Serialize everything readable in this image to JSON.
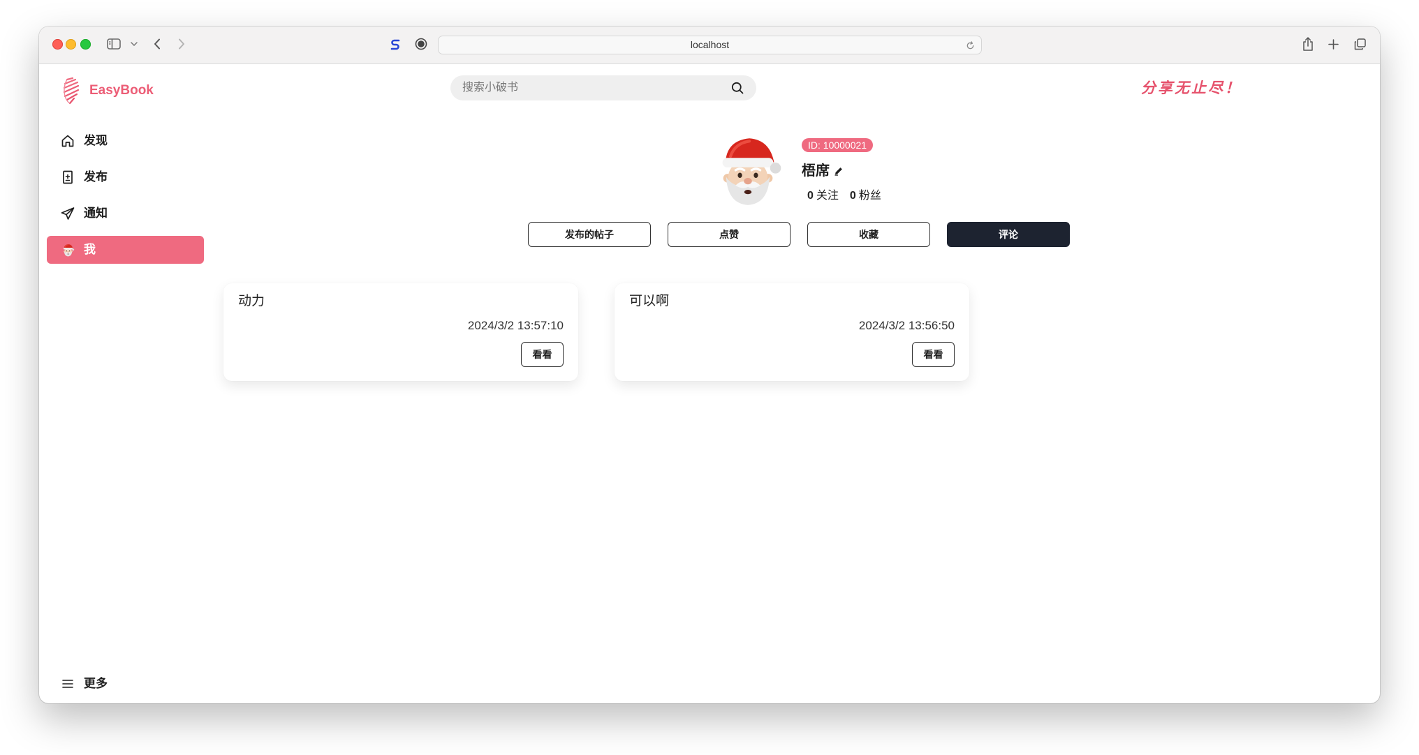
{
  "browser": {
    "url": "localhost"
  },
  "header": {
    "brand": "EasyBook",
    "search_placeholder": "搜索小破书",
    "slogan": "分享无止尽！"
  },
  "sidebar": {
    "items": [
      {
        "label": "发现",
        "icon": "home-icon",
        "active": false
      },
      {
        "label": "发布",
        "icon": "publish-icon",
        "active": false
      },
      {
        "label": "通知",
        "icon": "send-icon",
        "active": false
      },
      {
        "label": "我",
        "icon": "santa-avatar-icon",
        "active": true
      }
    ],
    "more": {
      "label": "更多",
      "icon": "menu-icon"
    }
  },
  "profile": {
    "id_badge": "ID: 10000021",
    "name": "梧席",
    "following": {
      "count": "0",
      "label": "关注"
    },
    "followers": {
      "count": "0",
      "label": "粉丝"
    }
  },
  "tabs": [
    {
      "label": "发布的帖子",
      "active": false
    },
    {
      "label": "点赞",
      "active": false
    },
    {
      "label": "收藏",
      "active": false
    },
    {
      "label": "评论",
      "active": true
    }
  ],
  "posts": [
    {
      "title": "动力",
      "date": "2024/3/2 13:57:10",
      "button": "看看"
    },
    {
      "title": "可以啊",
      "date": "2024/3/2 13:56:50",
      "button": "看看"
    }
  ],
  "colors": {
    "accent": "#ef6a80",
    "brand_text": "#ec5d76",
    "active_tab": "#1d2330"
  }
}
